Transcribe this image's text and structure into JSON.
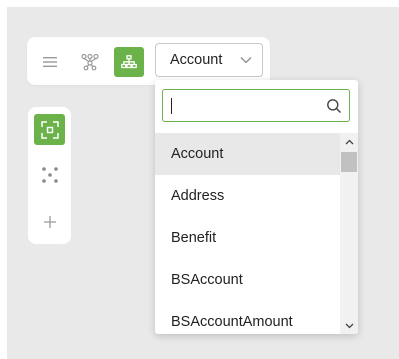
{
  "colors": {
    "accent": "#6cb24b",
    "canvas_bg": "#e9e9e9",
    "panel_bg": "#ffffff",
    "selected_item_bg": "#e8e8e8"
  },
  "toolbar": {
    "menu_icon": "hamburger-menu-icon",
    "tree_icon": "network-tree-icon",
    "hierarchy_icon": "hierarchy-icon",
    "model_select": {
      "value": "Account"
    }
  },
  "sidebar": {
    "fit_icon": "fit-to-screen-icon",
    "layout_icon": "dots-layout-icon",
    "add_icon": "plus-icon"
  },
  "dropdown": {
    "search": {
      "value": "",
      "placeholder": ""
    },
    "items": [
      {
        "label": "Account",
        "selected": true
      },
      {
        "label": "Address",
        "selected": false
      },
      {
        "label": "Benefit",
        "selected": false
      },
      {
        "label": "BSAccount",
        "selected": false
      },
      {
        "label": "BSAccountAmount",
        "selected": false
      }
    ]
  }
}
